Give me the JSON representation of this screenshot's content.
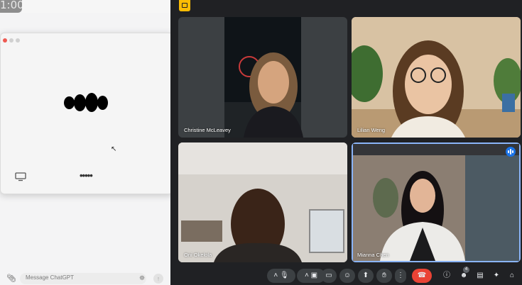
{
  "left_app": {
    "timer_text": "1:00",
    "composer": {
      "placeholder": "Message ChatGPT"
    }
  },
  "meet": {
    "participants": [
      {
        "name": "Christine McLeavey",
        "speaking": false
      },
      {
        "name": "Lilian Weng",
        "speaking": false
      },
      {
        "name": "Oni Okelola",
        "speaking": false
      },
      {
        "name": "Mianna Chen",
        "speaking": true
      }
    ],
    "participant_count": "4",
    "colors": {
      "end_call": "#ea4335",
      "accent": "#8ab4f8",
      "background": "#202124"
    }
  }
}
